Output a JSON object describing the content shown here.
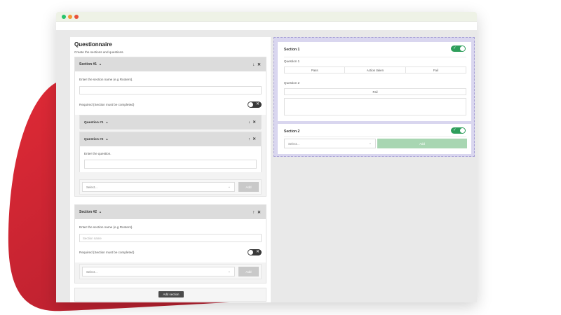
{
  "colors": {
    "accent_red": "#e8323c",
    "toggle_on": "#2e9e5b",
    "toggle_off": "#3a3a3a",
    "preview_bg": "#d9d6ef",
    "add_green": "#a8d6b2"
  },
  "questionnaire": {
    "title": "Questionnaire",
    "subtitle": "Create the sections and questions.",
    "sections": [
      {
        "header": "Section #1",
        "name_label": "Enter the section name (e.g Rooters).",
        "name_value": "",
        "required_label": "Required (Section must be completed)",
        "required": false,
        "questions": [
          {
            "header": "Question #1",
            "expanded": false
          },
          {
            "header": "Question #2",
            "expanded": true,
            "question_label": "Enter the question.",
            "question_value": ""
          }
        ],
        "select_placeholder": "Select...",
        "add_label": "Add"
      },
      {
        "header": "Section #2",
        "name_label": "Enter the section name (e.g Rooters).",
        "name_placeholder": "Section name",
        "required_label": "Required (Section must be completed)",
        "required": false,
        "select_placeholder": "Select...",
        "add_label": "Add"
      }
    ],
    "add_section_label": "Add section"
  },
  "preview": {
    "sections": [
      {
        "title": "Section 1",
        "enabled": true,
        "questions": [
          {
            "label": "Question 1",
            "options": [
              "Pass",
              "Action taken",
              "Fail"
            ]
          },
          {
            "label": "Question 2",
            "options": [
              "Fail"
            ]
          }
        ]
      },
      {
        "title": "Section 2",
        "enabled": true,
        "select_placeholder": "Select...",
        "add_label": "Add"
      }
    ]
  },
  "icons": {
    "section_controls": "↓ ✕",
    "section_controls_up": "↑ ✕",
    "caret": "▲",
    "chevron": "⌄",
    "check": "✓",
    "x": "✕"
  }
}
